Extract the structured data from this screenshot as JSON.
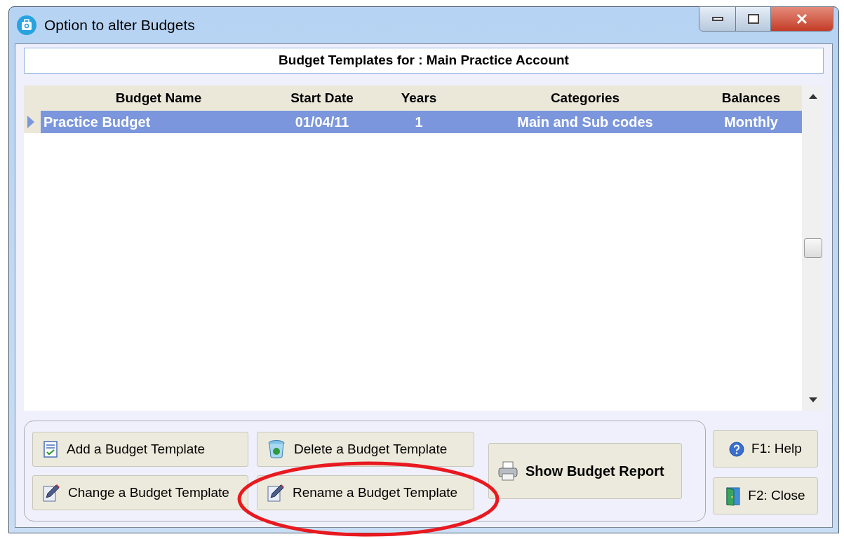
{
  "window": {
    "title": "Option to alter Budgets"
  },
  "header": {
    "text": "Budget Templates for : Main Practice Account"
  },
  "table": {
    "columns": [
      "Budget Name",
      "Start Date",
      "Years",
      "Categories",
      "Balances"
    ],
    "rows": [
      {
        "cells": [
          "Practice Budget",
          "01/04/11",
          "1",
          "Main and Sub codes",
          "Monthly"
        ],
        "selected": true
      }
    ]
  },
  "template_buttons": [
    {
      "label": "Add a Budget Template",
      "kind": "add"
    },
    {
      "label": "Delete a Budget Template",
      "kind": "delete"
    },
    {
      "label": "Change a Budget Template",
      "kind": "change"
    },
    {
      "label": "Rename a Budget Template",
      "kind": "rename"
    }
  ],
  "report_button": {
    "label": "Show Budget Report"
  },
  "side_buttons": [
    {
      "label": "F1: Help",
      "kind": "help"
    },
    {
      "label": "F2: Close",
      "kind": "close"
    }
  ]
}
